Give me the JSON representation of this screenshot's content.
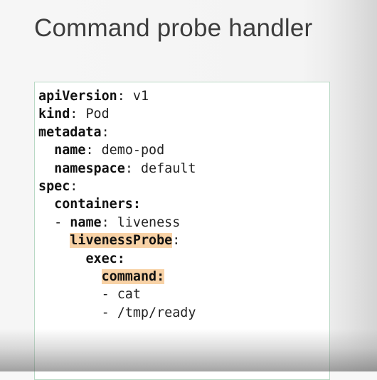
{
  "slide": {
    "title": "Command probe handler"
  },
  "code_lines": [
    [
      {
        "t": "apiVersion",
        "s": "k"
      },
      {
        "t": ": v1"
      }
    ],
    [
      {
        "t": "kind",
        "s": "k"
      },
      {
        "t": ": Pod"
      }
    ],
    [
      {
        "t": "metadata",
        "s": "k"
      },
      {
        "t": ":"
      }
    ],
    [
      {
        "t": "  "
      },
      {
        "t": "name",
        "s": "k"
      },
      {
        "t": ": demo-pod"
      }
    ],
    [
      {
        "t": "  "
      },
      {
        "t": "namespace",
        "s": "k"
      },
      {
        "t": ": default"
      }
    ],
    [
      {
        "t": "spec",
        "s": "k"
      },
      {
        "t": ":"
      }
    ],
    [
      {
        "t": "  "
      },
      {
        "t": "containers",
        "s": "k"
      },
      {
        "t": ":",
        "s": "k"
      }
    ],
    [
      {
        "t": "  - "
      },
      {
        "t": "name",
        "s": "k"
      },
      {
        "t": ": liveness"
      }
    ],
    [
      {
        "t": "    "
      },
      {
        "t": "livenessProbe",
        "s": "hl"
      },
      {
        "t": ":"
      }
    ],
    [
      {
        "t": "      "
      },
      {
        "t": "exec",
        "s": "k"
      },
      {
        "t": ":",
        "s": "k"
      }
    ],
    [
      {
        "t": "        "
      },
      {
        "t": "command:",
        "s": "hl"
      }
    ],
    [
      {
        "t": "        - cat"
      }
    ],
    [
      {
        "t": "        - /tmp/ready"
      }
    ]
  ],
  "colors": {
    "highlight": "#f8d2a6",
    "box_border": "#b9d9c5",
    "title": "#3c3c3c"
  }
}
